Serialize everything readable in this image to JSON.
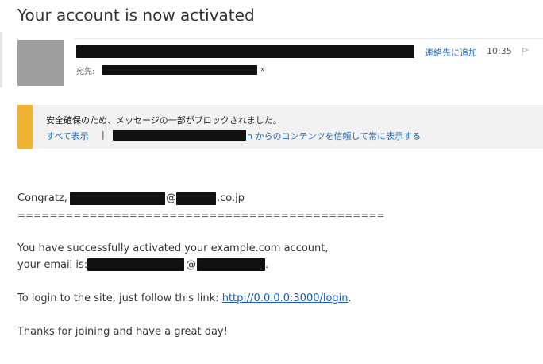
{
  "email": {
    "subject": "Your account is now activated",
    "to_label": "宛先:",
    "to_expand_icon": "double-chevron-down-icon",
    "add_contact": "連絡先に追加",
    "time": "10:35",
    "flag_icon": "flag-icon"
  },
  "warning": {
    "accent_color": "#f1b233",
    "message": "安全確保のため、メッセージの一部がブロックされました。",
    "show_all": "すべて表示",
    "separator": "|",
    "trust_text": "n からのコンテンツを信頼して常に表示する"
  },
  "body": {
    "greeting_prefix": "Congratz,",
    "greeting_at": "@",
    "greeting_domain": ".co.jp",
    "divider": "==============================================",
    "line1": "You have successfully activated your example.com account,",
    "line2_prefix": "your email is:",
    "line2_at": "@",
    "line2_end": ".",
    "login_prefix": "To login to the site, just follow this link:",
    "login_link": "http://0.0.0.0:3000/login",
    "login_suffix": ".",
    "closing": "Thanks for joining and have a great day!"
  }
}
